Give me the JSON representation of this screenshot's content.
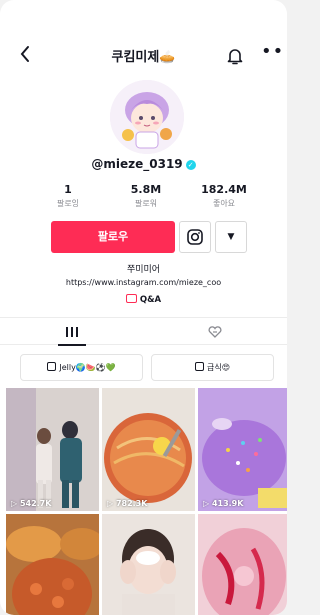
{
  "header": {
    "title": "쿠킴미제🥧",
    "back_icon": "back-arrow-icon",
    "bell_icon": "bell-icon",
    "more_icon": "more-icon"
  },
  "profile": {
    "username": "@mieze_0319",
    "verified": true,
    "stats": [
      {
        "value": "1",
        "label": "팔로잉"
      },
      {
        "value": "5.8M",
        "label": "팔로워"
      },
      {
        "value": "182.4M",
        "label": "좋아요"
      }
    ],
    "follow_label": "팔로우",
    "bio": "쭈미미어",
    "link": "https://www.instagram.com/mieze_coo",
    "qa_label": "Q&A"
  },
  "tabs": [
    "videos",
    "liked"
  ],
  "playlists": [
    {
      "label": "Jelly🌍🍉⚽💚"
    },
    {
      "label": "급식😍"
    }
  ],
  "videos": [
    {
      "views": "542.7K"
    },
    {
      "views": "782.3K"
    },
    {
      "views": "413.9K"
    },
    {
      "views": ""
    },
    {
      "views": ""
    },
    {
      "views": ""
    }
  ],
  "colors": {
    "accent": "#fe2c55",
    "verified": "#20d5ec"
  }
}
